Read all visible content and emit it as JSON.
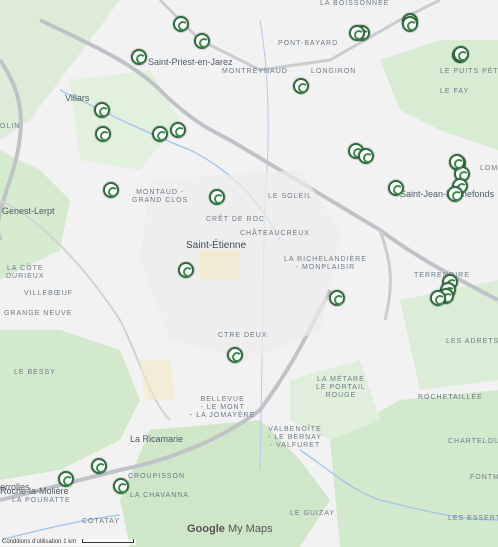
{
  "map": {
    "labels": [
      {
        "text": "Saint-Priest-en-Jarez",
        "kind": "city"
      },
      {
        "text": "Villars",
        "kind": "city"
      },
      {
        "text": "Saint-Étienne",
        "kind": "city-big"
      },
      {
        "text": "La Ricamarie",
        "kind": "city"
      },
      {
        "text": "Genest-Lerpt",
        "kind": "city"
      },
      {
        "text": "Saint-Jean-Bonnefonds",
        "kind": "city"
      },
      {
        "text": "Roche-la-Molière",
        "kind": "city"
      },
      {
        "text": "PONT-BAYARD",
        "kind": "district"
      },
      {
        "text": "MONTREYNAUD",
        "kind": "district"
      },
      {
        "text": "LONGIRON",
        "kind": "district"
      },
      {
        "text": "LE PUITS PÉTIT",
        "kind": "district"
      },
      {
        "text": "LE FAY",
        "kind": "district"
      },
      {
        "text": "MONTAUD -\nGRAND CLOS",
        "kind": "district"
      },
      {
        "text": "LE SOLEIL",
        "kind": "district"
      },
      {
        "text": "CRÊT DE ROC",
        "kind": "district"
      },
      {
        "text": "CHÂTEAUCREUX",
        "kind": "district"
      },
      {
        "text": "LA RICHELANDIÈRE\n- MONPLAISIR",
        "kind": "district"
      },
      {
        "text": "TERRENOIRE",
        "kind": "district"
      },
      {
        "text": "LA CÔTE\nDURIEUX",
        "kind": "district"
      },
      {
        "text": "VILLEBŒUF",
        "kind": "district"
      },
      {
        "text": "GRANGE NEUVE",
        "kind": "district"
      },
      {
        "text": "LE BESSY",
        "kind": "district"
      },
      {
        "text": "CTRE DEUX",
        "kind": "district"
      },
      {
        "text": "LES ADRETS",
        "kind": "district"
      },
      {
        "text": "LA MÉTARE\nLE PORTAIL\nROUGE",
        "kind": "district"
      },
      {
        "text": "ROCHETAILLÉE",
        "kind": "district"
      },
      {
        "text": "BELLEVUE\n- LE MONT\n- LA JOMAYÈRE",
        "kind": "district"
      },
      {
        "text": "VALBENOÎTE\n- LE BERNAY\n- VALFURET",
        "kind": "district"
      },
      {
        "text": "CHARTELOUP",
        "kind": "district"
      },
      {
        "text": "CROUPISSON",
        "kind": "district"
      },
      {
        "text": "LA CHAVANNA",
        "kind": "district"
      },
      {
        "text": "LA POURATTE",
        "kind": "district"
      },
      {
        "text": "COTATAY",
        "kind": "district"
      },
      {
        "text": "LE GUIZAY",
        "kind": "district"
      },
      {
        "text": "FONTM",
        "kind": "district"
      },
      {
        "text": "LES ESSERTIN",
        "kind": "district"
      },
      {
        "text": "LA BOISSONNÉE",
        "kind": "district"
      },
      {
        "text": "OLIN",
        "kind": "district"
      },
      {
        "text": "LOMBI",
        "kind": "district"
      },
      {
        "text": "errolles",
        "kind": "city"
      }
    ],
    "marker_count": 34,
    "footer": {
      "brand_google": "Google",
      "brand_mymaps": "My Maps"
    },
    "scale": {
      "terms": "Conditions d'utilisation",
      "distance": "1 km"
    }
  }
}
